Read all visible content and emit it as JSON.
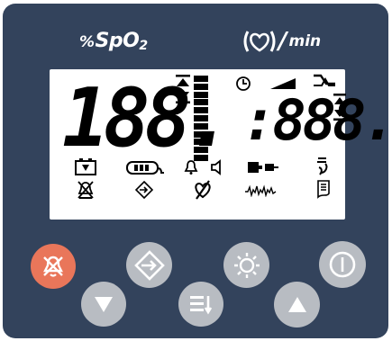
{
  "header": {
    "spo2_percent": "%",
    "spo2_label_main": "SpO",
    "spo2_label_sub": "2",
    "pulse_slash": "/",
    "pulse_unit": "min"
  },
  "lcd": {
    "spo2_digits": "188.",
    "pulse_colon": ":",
    "pulse_digits": "888."
  },
  "icons": [
    "battery-charging-icon",
    "battery-level-icon",
    "alarm-bell-icon",
    "speaker-icon",
    "sensor-plug-icon",
    "finger-probe-icon",
    "alarm-off-icon",
    "enter-icon",
    "pulse-search-icon",
    "pleth-wave-icon",
    "record-icon",
    "clock-icon",
    "volume-ramp-icon",
    "trend-icon",
    "up-down-arrows-icon"
  ],
  "buttons": [
    {
      "name": "alarm-silence-button",
      "icon": "alarm-off-icon"
    },
    {
      "name": "down-button",
      "icon": "triangle-down-icon"
    },
    {
      "name": "enter-button",
      "icon": "enter-icon"
    },
    {
      "name": "menu-button",
      "icon": "menu-list-icon"
    },
    {
      "name": "brightness-button",
      "icon": "sun-icon"
    },
    {
      "name": "up-button",
      "icon": "triangle-up-icon"
    },
    {
      "name": "power-button",
      "icon": "power-icon"
    }
  ],
  "colors": {
    "panel": "#33435c",
    "lcd_background": "#ffffff",
    "button_grey": "#b8bcc2",
    "alarm_button": "#e9765a"
  }
}
